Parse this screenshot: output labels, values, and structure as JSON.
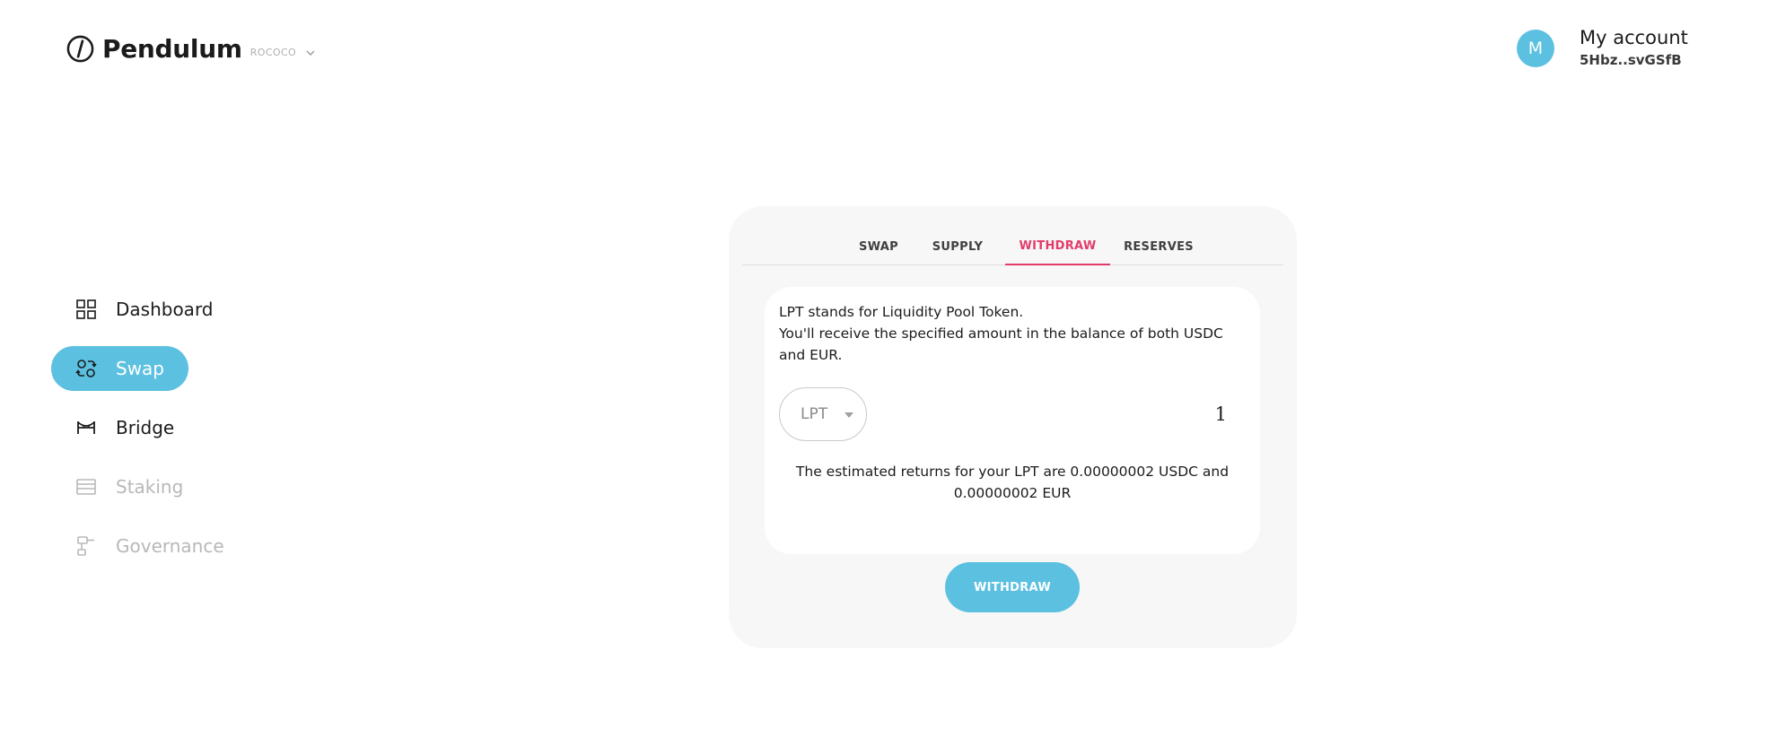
{
  "brand": {
    "name": "Pendulum",
    "network": "ROCOCO",
    "logo_icon": "pendulum-logo-icon"
  },
  "account": {
    "avatar_initial": "M",
    "title": "My account",
    "address": "5Hbz..svGSfB"
  },
  "sidebar": {
    "items": [
      {
        "label": "Dashboard",
        "icon": "grid-icon",
        "state": "normal"
      },
      {
        "label": "Swap",
        "icon": "swap-icon",
        "state": "active"
      },
      {
        "label": "Bridge",
        "icon": "bridge-icon",
        "state": "normal"
      },
      {
        "label": "Staking",
        "icon": "staking-icon",
        "state": "disabled"
      },
      {
        "label": "Governance",
        "icon": "governance-icon",
        "state": "disabled"
      }
    ]
  },
  "tabs": [
    {
      "label": "SWAP"
    },
    {
      "label": "SUPPLY"
    },
    {
      "label": "WITHDRAW",
      "active": true
    },
    {
      "label": "RESERVES"
    }
  ],
  "withdraw": {
    "info_line1": "LPT stands for Liquidity Pool Token.",
    "info_line2": "You'll receive the specified amount in the balance of both USDC and EUR.",
    "token": "LPT",
    "amount": "1",
    "estimate": "The estimated returns for your LPT are 0.00000002 USDC and 0.00000002 EUR",
    "button_label": "WITHDRAW"
  },
  "colors": {
    "accent": "#5cc0e1",
    "active_tab": "#e23b6a",
    "card_bg": "#f7f7f7",
    "disabled_text": "#b8b8b8"
  }
}
